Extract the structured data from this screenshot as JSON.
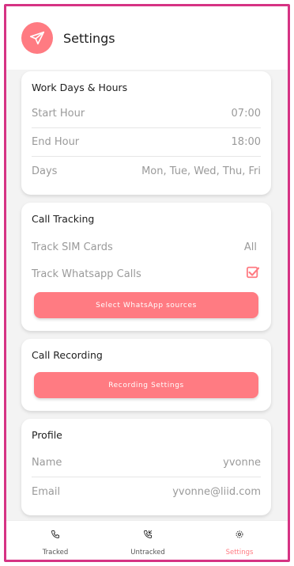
{
  "header": {
    "title": "Settings",
    "logo_icon": "paper-plane-icon"
  },
  "work_days": {
    "title": "Work Days & Hours",
    "rows": [
      {
        "label": "Start Hour",
        "value": "07:00"
      },
      {
        "label": "End Hour",
        "value": "18:00"
      },
      {
        "label": "Days",
        "value": "Mon, Tue, Wed, Thu, Fri"
      }
    ]
  },
  "call_tracking": {
    "title": "Call Tracking",
    "sim_label": "Track SIM Cards",
    "sim_value": "All",
    "whatsapp_label": "Track Whatsapp Calls",
    "whatsapp_checked": true,
    "sources_button": "Select WhatsApp sources"
  },
  "call_recording": {
    "title": "Call Recording",
    "settings_button": "Recording Settings"
  },
  "profile": {
    "title": "Profile",
    "rows": [
      {
        "label": "Name",
        "value": "yvonne"
      },
      {
        "label": "Email",
        "value": "yvonne@liid.com"
      }
    ]
  },
  "bottom_nav": {
    "items": [
      {
        "label": "Tracked",
        "icon": "phone-icon",
        "active": false
      },
      {
        "label": "Untracked",
        "icon": "phone-incoming-icon",
        "active": false
      },
      {
        "label": "Settings",
        "icon": "gear-icon",
        "active": true
      }
    ]
  },
  "colors": {
    "accent": "#ff7b82",
    "frame": "#d63384"
  }
}
